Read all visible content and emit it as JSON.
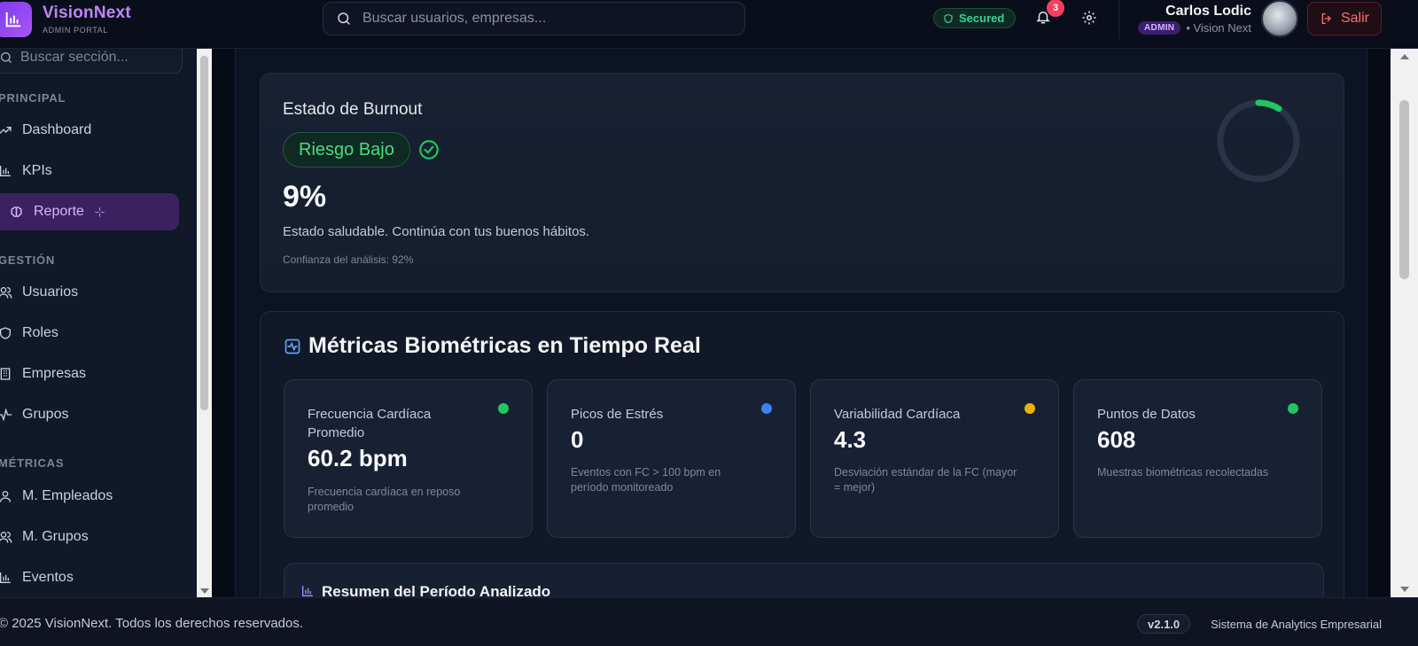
{
  "header": {
    "brand_name": "VisionNext",
    "brand_sub": "ADMIN PORTAL",
    "search_placeholder": "Buscar usuarios, empresas...",
    "secured_label": "Secured",
    "notification_count": "3",
    "user_name": "Carlos Lodic",
    "user_role": "ADMIN",
    "user_org": "• Vision Next",
    "logout_label": "Salir"
  },
  "sidebar": {
    "search_placeholder": "Buscar sección...",
    "sections": [
      {
        "label": "PRINCIPAL"
      },
      {
        "label": "GESTIÓN"
      },
      {
        "label": "MÉTRICAS"
      }
    ],
    "items": [
      {
        "label": "Dashboard",
        "icon": "trending-up-icon"
      },
      {
        "label": "KPIs",
        "icon": "bar-chart-icon"
      },
      {
        "label": "Reporte",
        "icon": "brain-icon",
        "active": true
      },
      {
        "label": "Usuarios",
        "icon": "users-icon"
      },
      {
        "label": "Roles",
        "icon": "shield-icon"
      },
      {
        "label": "Empresas",
        "icon": "building-icon"
      },
      {
        "label": "Grupos",
        "icon": "activity-icon"
      },
      {
        "label": "M. Empleados",
        "icon": "user-icon"
      },
      {
        "label": "M. Grupos",
        "icon": "users-icon"
      },
      {
        "label": "Eventos",
        "icon": "bar-chart-icon"
      }
    ]
  },
  "burnout": {
    "title": "Estado de Burnout",
    "risk_label": "Riesgo Bajo",
    "percent": "9%",
    "percent_value": 9,
    "description": "Estado saludable. Continúa con tus buenos hábitos.",
    "confidence": "Confianza del análisis: 92%"
  },
  "biometrics": {
    "title": "Métricas Biométricas en Tiempo Real",
    "metrics": [
      {
        "label": "Frecuencia Cardíaca Promedio",
        "value": "60.2 bpm",
        "note": "Frecuencia cardíaca en reposo promedio",
        "dot_color": "#22c55e"
      },
      {
        "label": "Picos de Estrés",
        "value": "0",
        "note": "Eventos con FC > 100 bpm en período monitoreado",
        "dot_color": "#3b82f6"
      },
      {
        "label": "Variabilidad Cardíaca",
        "value": "4.3",
        "note": "Desviación estándar de la FC (mayor = mejor)",
        "dot_color": "#eab308"
      },
      {
        "label": "Puntos de Datos",
        "value": "608",
        "note": "Muestras biométricas recolectadas",
        "dot_color": "#22c55e"
      }
    ],
    "summary_title": "Resumen del Período Analizado"
  },
  "footer": {
    "copyright": "© 2025 VisionNext. Todos los derechos reservados.",
    "version": "v2.1.0",
    "system": "Sistema de Analytics Empresarial"
  },
  "colors": {
    "accent": "#a855f7",
    "success": "#22c55e",
    "danger": "#f43f5e"
  }
}
